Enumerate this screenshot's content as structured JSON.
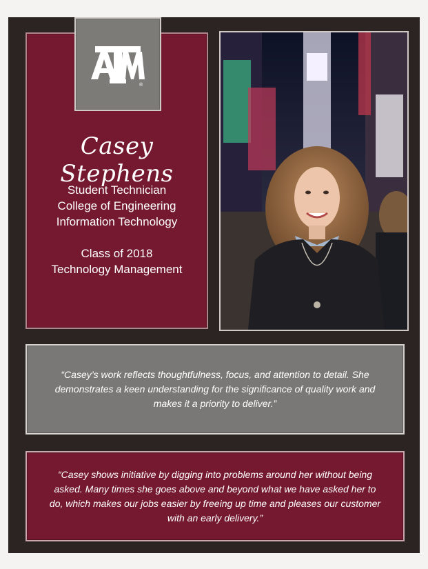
{
  "logo": {
    "text": "ATM",
    "registered": "®"
  },
  "profile": {
    "name": "Casey Stephens",
    "role_lines": [
      "Student Technician",
      "College of Engineering",
      "Information Technology"
    ],
    "class_lines": [
      "Class of 2018",
      "Technology Management"
    ]
  },
  "quotes": [
    {
      "text": "“Casey’s work reflects thoughtfulness, focus, and attention to detail. She demonstrates a keen understanding for the significance of quality work and makes it a priority to deliver.”"
    },
    {
      "text": "“Casey shows initiative by digging into problems around her without being asked. Many times she goes above and beyond what we have asked her to do, which makes our jobs easier by freeing up time and pleases our customer with an early delivery.”"
    }
  ],
  "colors": {
    "maroon": "#74192f",
    "gray": "#7a7876",
    "background": "#2b2423"
  }
}
